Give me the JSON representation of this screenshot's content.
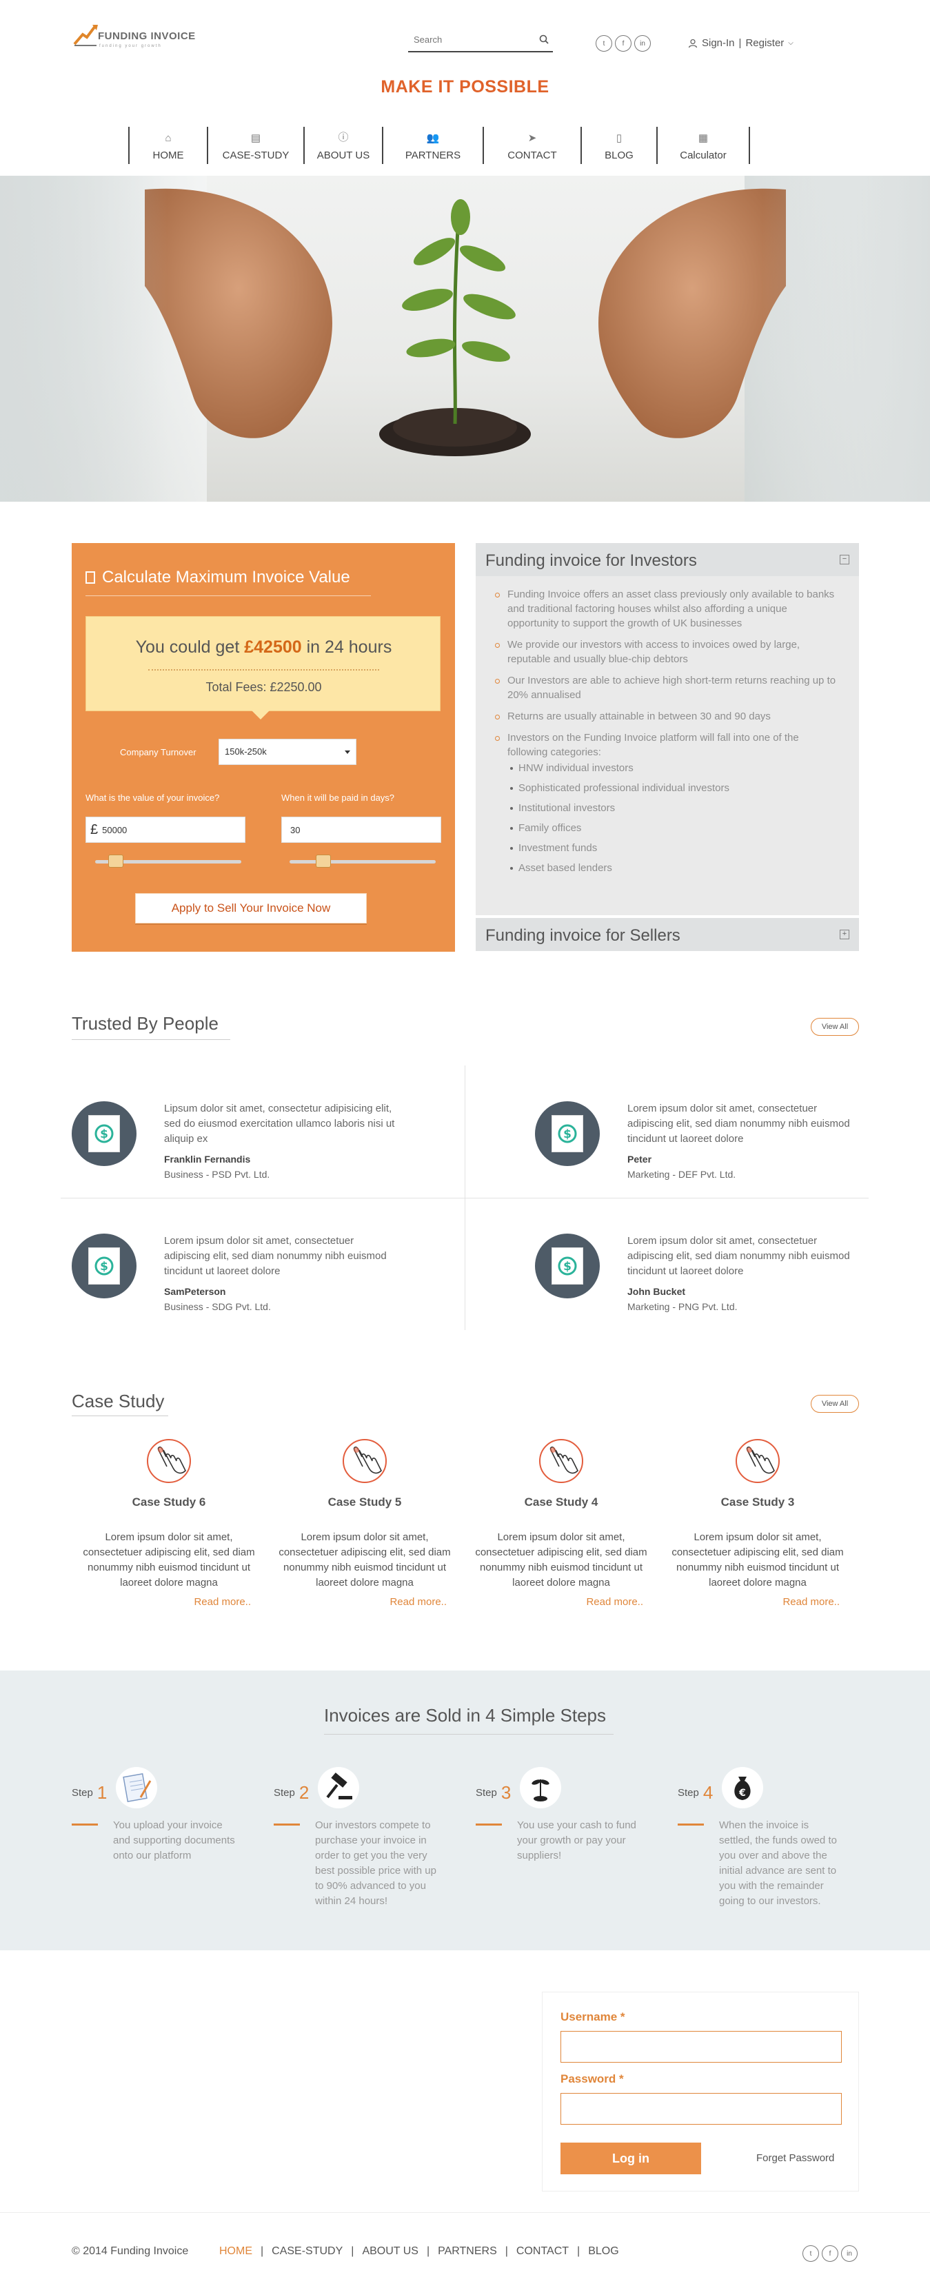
{
  "header": {
    "logo_name": "FUNDING INVOICE",
    "logo_tagline": "funding your growth",
    "search_placeholder": "Search",
    "social": [
      "twitter-icon",
      "facebook-icon",
      "linkedin-icon"
    ],
    "signin": "Sign-In",
    "separator": "|",
    "register": "Register",
    "tagline": "MAKE IT POSSIBLE"
  },
  "nav": [
    {
      "label": "HOME",
      "icon": "home-icon",
      "glyph": "⌂"
    },
    {
      "label": "CASE-STUDY",
      "icon": "book-icon",
      "glyph": "▤"
    },
    {
      "label": "ABOUT US",
      "icon": "info-icon",
      "glyph": "ⓘ"
    },
    {
      "label": "PARTNERS",
      "icon": "users-icon",
      "glyph": "👥"
    },
    {
      "label": "CONTACT",
      "icon": "send-icon",
      "glyph": "➤"
    },
    {
      "label": "BLOG",
      "icon": "document-icon",
      "glyph": "▯"
    },
    {
      "label": "Calculator",
      "icon": "calculator-icon",
      "glyph": "▦"
    }
  ],
  "calculator": {
    "title": "Calculate Maximum Invoice Value",
    "you_could_get": "You could get",
    "amount": "£42500",
    "in_hours": "in 24 hours",
    "total_fees": "Total Fees: £2250.00",
    "turnover_label": "Company Turnover",
    "turnover_value": "150k-250k",
    "invoice_value_label": "What is the value of your invoice?",
    "invoice_value": "50000",
    "currency": "£",
    "paid_label": "When it will be paid in days?",
    "paid_value": "30",
    "invoice_slider_level": 0.1,
    "days_slider_level": 0.2,
    "apply_button": "Apply to Sell Your Invoice Now"
  },
  "investors": {
    "title": "Funding invoice for Investors",
    "toggle": "−",
    "items": [
      "Funding Invoice offers an asset class previously only available to banks and traditional factoring houses whilst also affording a unique opportunity to support the growth of UK businesses",
      "We provide our investors with access to invoices owed by large, reputable and usually blue-chip debtors",
      "Our Investors are able to achieve high short-term returns reaching up to 20% annualised",
      "Returns are usually attainable in between 30 and 90 days",
      "Investors on the Funding Invoice platform will fall into one of the following categories:"
    ],
    "categories": [
      "HNW individual investors",
      "Sophisticated professional individual investors",
      "Institutional investors",
      "Family offices",
      "Investment funds",
      "Asset based lenders"
    ]
  },
  "sellers": {
    "title": "Funding invoice for Sellers",
    "toggle": "+"
  },
  "trusted": {
    "title": "Trusted By People",
    "view_all": "View All",
    "testimonials": [
      {
        "quote": "Lipsum dolor sit amet, consectetur adipisicing elit, sed do eiusmod exercitation ullamco laboris nisi ut aliquip ex",
        "name": "Franklin Fernandis",
        "role": "Business - PSD Pvt. Ltd."
      },
      {
        "quote": "Lorem ipsum dolor sit amet, consectetuer adipiscing elit, sed diam nonummy nibh euismod tincidunt ut laoreet dolore",
        "name": "Peter",
        "role": "Marketing - DEF Pvt. Ltd."
      },
      {
        "quote": "Lorem ipsum dolor sit amet, consectetuer adipiscing elit, sed diam nonummy nibh euismod tincidunt ut laoreet dolore",
        "name": "SamPeterson",
        "role": "Business - SDG Pvt. Ltd."
      },
      {
        "quote": "Lorem ipsum dolor sit amet, consectetuer adipiscing elit, sed diam nonummy nibh euismod tincidunt ut laoreet dolore",
        "name": "John Bucket",
        "role": "Marketing - PNG Pvt. Ltd."
      }
    ]
  },
  "case_study": {
    "title": "Case Study",
    "view_all": "View All",
    "items": [
      {
        "title": "Case Study 6",
        "text": "Lorem ipsum dolor sit amet, consectetuer adipiscing elit, sed diam nonummy nibh euismod tincidunt ut laoreet dolore magna",
        "read_more": "Read more.."
      },
      {
        "title": "Case Study 5",
        "text": "Lorem ipsum dolor sit amet, consectetuer adipiscing elit, sed diam nonummy nibh euismod tincidunt ut laoreet dolore magna",
        "read_more": "Read more.."
      },
      {
        "title": "Case Study 4",
        "text": "Lorem ipsum dolor sit amet, consectetuer adipiscing elit, sed diam nonummy nibh euismod tincidunt ut laoreet dolore magna",
        "read_more": "Read more.."
      },
      {
        "title": "Case Study 3",
        "text": "Lorem ipsum dolor sit amet, consectetuer adipiscing elit, sed diam nonummy nibh euismod tincidunt ut laoreet dolore magna",
        "read_more": "Read more.."
      }
    ]
  },
  "steps": {
    "title": "Invoices are Sold in 4 Simple Steps",
    "step_word": "Step",
    "items": [
      {
        "num": "1",
        "icon": "document-pen-icon",
        "text": "You upload your invoice and supporting documents onto our platform"
      },
      {
        "num": "2",
        "icon": "gavel-icon",
        "text": "Our investors compete to purchase your invoice in order to get you the very best possible price with up to 90% advanced to you within 24 hours!"
      },
      {
        "num": "3",
        "icon": "plant-icon",
        "text": "You use your cash to fund your growth or pay your suppliers!"
      },
      {
        "num": "4",
        "icon": "money-bag-icon",
        "text": "When the invoice is settled, the funds owed to you over and above the initial advance are sent to you with the remainder going to our investors."
      }
    ]
  },
  "login": {
    "username_label": "Username *",
    "password_label": "Password *",
    "button": "Log in",
    "forget": "Forget Password"
  },
  "footer": {
    "copyright": "© 2014 Funding Invoice",
    "links": [
      "HOME",
      "CASE-STUDY",
      "ABOUT US",
      "PARTNERS",
      "CONTACT",
      "BLOG"
    ],
    "separator": "|"
  },
  "colors": {
    "accent": "#e0863a",
    "calc_bg": "#ec914a",
    "tagline": "#e0622a"
  }
}
